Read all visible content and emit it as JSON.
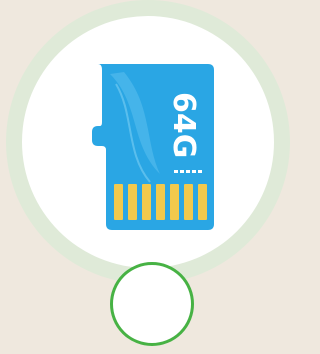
{
  "item": {
    "icon": "microsd-card-icon",
    "capacity_label": "64G"
  },
  "colors": {
    "background": "#efe8de",
    "ring": "#dfead8",
    "card_blue": "#2aa6e4",
    "contacts_gold": "#f2c94c",
    "select_circle_border": "#47b244"
  },
  "select_control": {
    "icon": "radio-circle-icon",
    "selected": false
  }
}
